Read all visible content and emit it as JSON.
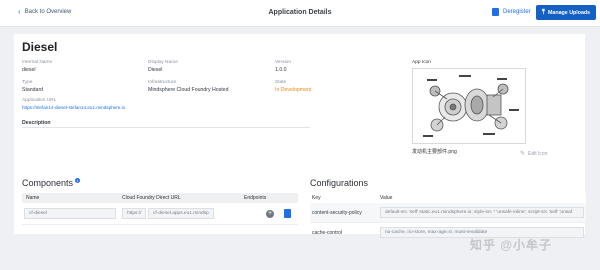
{
  "header": {
    "back_label": "Back to Overview",
    "title": "Application Details",
    "deregister_label": "Deregister",
    "manage_uploads_label": "Manage Uploads"
  },
  "app": {
    "name": "Diesel",
    "internal_name_label": "Internal Name",
    "internal_name": "diesel",
    "display_name_label": "Display Name",
    "display_name": "Diesel",
    "version_label": "Version",
    "version": "1.0.0",
    "type_label": "Type",
    "type": "Standard",
    "infrastructure_label": "Infrastructure",
    "infrastructure": "Mindsphere Cloud Foundry Hosted",
    "state_label": "State",
    "state": "In Development",
    "state_color": "#ef8a17",
    "url_label": "Application URL",
    "url": "https://stefan14-diesel-stefan14.eu1.mindsphere.io",
    "description_label": "Description",
    "app_icon_label": "App Icon",
    "app_icon_filename": "发动机主要部件.png",
    "edit_icon_label": "Edit Icon"
  },
  "components": {
    "title": "Components",
    "columns": [
      "Name",
      "Cloud Foundry Direct URL",
      "Endpoints"
    ],
    "rows": [
      {
        "name": "cf-diesel",
        "url_prefix": "https://",
        "url": "cf-diesel.apps.eu1.mindsp"
      }
    ]
  },
  "configurations": {
    "title": "Configurations",
    "columns": [
      "Key",
      "Value"
    ],
    "rows": [
      {
        "key": "content-security-policy",
        "value": "default-src 'self' static.eu1.mindsphere.io; style-src * 'unsafe-inline'; script-src 'self' 'unsaf"
      },
      {
        "key": "cache-control",
        "value": "no-cache, no-store, max-age=0, must-revalidate"
      }
    ]
  },
  "watermark": "知乎 @小牟子",
  "colors": {
    "primary": "#1560c4",
    "link": "#1f6feb",
    "background": "#eef0f3"
  }
}
